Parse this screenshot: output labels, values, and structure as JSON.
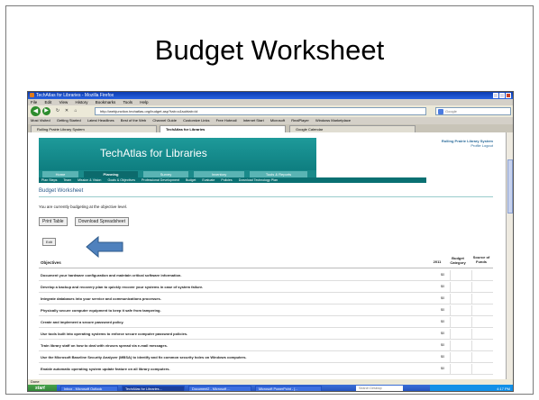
{
  "slide": {
    "title": "Budget Worksheet"
  },
  "browser": {
    "window_title": "TechAtlas for Libraries - Mozilla Firefox",
    "menu": [
      "File",
      "Edit",
      "View",
      "History",
      "Bookmarks",
      "Tools",
      "Help"
    ],
    "url": "http://webjunction.techatlas.org/budget.asp?tab=c&subtab=id",
    "search_placeholder": "Google",
    "bookmarks": [
      "Most Visited",
      "Getting Started",
      "Latest Headlines",
      "Best of the Web",
      "Channel Guide",
      "Customize Links",
      "Free Hotmail",
      "Internet Start",
      "Microsoft",
      "RealPlayer",
      "Windows Marketplace"
    ],
    "tabs": [
      "Rolling Prairie Library System",
      "TechAtlas for Libraries",
      "Google Calendar"
    ],
    "status": "Done"
  },
  "site": {
    "brand": "TechAtlas for Libraries",
    "org_name": "Rolling Prairie Library System",
    "org_links": "Profile   Logout",
    "nav_tabs": [
      "Home",
      "Planning",
      "Survey",
      "Inventory",
      "Tools & Reports"
    ],
    "subnav": [
      "Plan Steps",
      "Team",
      "Mission & Vision",
      "Goals & Objectives",
      "Professional Development",
      "Budget",
      "Evaluate",
      "Policies",
      "Download Technology Plan"
    ],
    "heading": "Budget Worksheet",
    "info": "You are currently budgeting at the objective level.",
    "print_button": "Print Table",
    "download_button": "Download Spreadsheet",
    "edit_button": "Edit"
  },
  "table": {
    "headers": {
      "objectives": "Objectives",
      "year": "2011",
      "category": "Budget Category",
      "source": "Source of Funds"
    },
    "rows": [
      {
        "objective": "Document your hardware configuration and maintain critical software information.",
        "amount": "$0"
      },
      {
        "objective": "Develop a backup and recovery plan to quickly recover your systems in case of system failure.",
        "amount": "$0"
      },
      {
        "objective": "Integrate databases into your service and communications processes.",
        "amount": "$0"
      },
      {
        "objective": "Physically secure computer equipment to keep it safe from tampering.",
        "amount": "$0"
      },
      {
        "objective": "Create and implement a secure password policy.",
        "amount": "$0"
      },
      {
        "objective": "Use tools built into operating systems to enforce secure computer password policies.",
        "amount": "$0"
      },
      {
        "objective": "Train library staff on how to deal with viruses spread via e-mail messages.",
        "amount": "$0"
      },
      {
        "objective": "Use the Microsoft Baseline Security Analyzer (MBSA) to identify and fix common security holes on Windows computers.",
        "amount": "$0"
      },
      {
        "objective": "Enable automatic operating system update feature on all library computers.",
        "amount": "$0"
      }
    ]
  },
  "taskbar": {
    "start": "start",
    "items": [
      "Inbox - Microsoft Outlook",
      "TechAtlas for Libraries...",
      "Document2 - Microsoft ...",
      "Microsoft PowerPoint - [..."
    ],
    "search_placeholder": "Search Desktop",
    "clock": "4:17 PM"
  }
}
